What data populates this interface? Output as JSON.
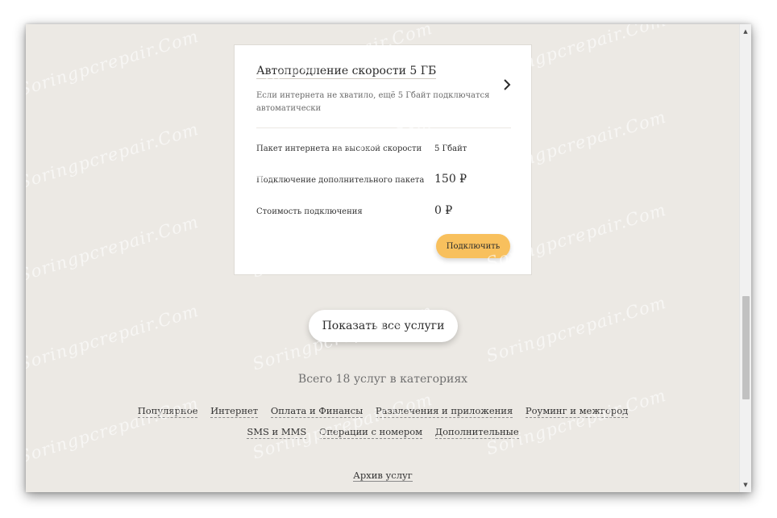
{
  "card": {
    "title": "Автопродление скорости 5 ГБ",
    "description": "Если интернета не хватило, ещё 5 Гбайт подключатся автоматически",
    "rows": [
      {
        "label": "Пакет интернета на высокой скорости",
        "value": "5 Гбайт"
      },
      {
        "label": "Подключение дополнительного пакета",
        "value": "150 ₽"
      },
      {
        "label": "Стоимость подключения",
        "value": "0 ₽"
      }
    ],
    "connect_label": "Подключить",
    "chevron_icon": "chevron-right-icon"
  },
  "show_all_label": "Показать все услуги",
  "total_text": "Всего 18 услуг в категориях",
  "categories_row1": [
    "Популярное",
    "Интернет",
    "Оплата и Финансы",
    "Развлечения и приложения",
    "Роуминг и межгород"
  ],
  "categories_row2": [
    "SMS и MMS",
    "Операции с номером",
    "Дополнительные"
  ],
  "archive_label": "Архив услуг",
  "watermark": "Soringpcrepair.Com",
  "colors": {
    "page_background": "#ece9e4",
    "accent_button": "#f8c05d",
    "card_background": "#ffffff"
  }
}
